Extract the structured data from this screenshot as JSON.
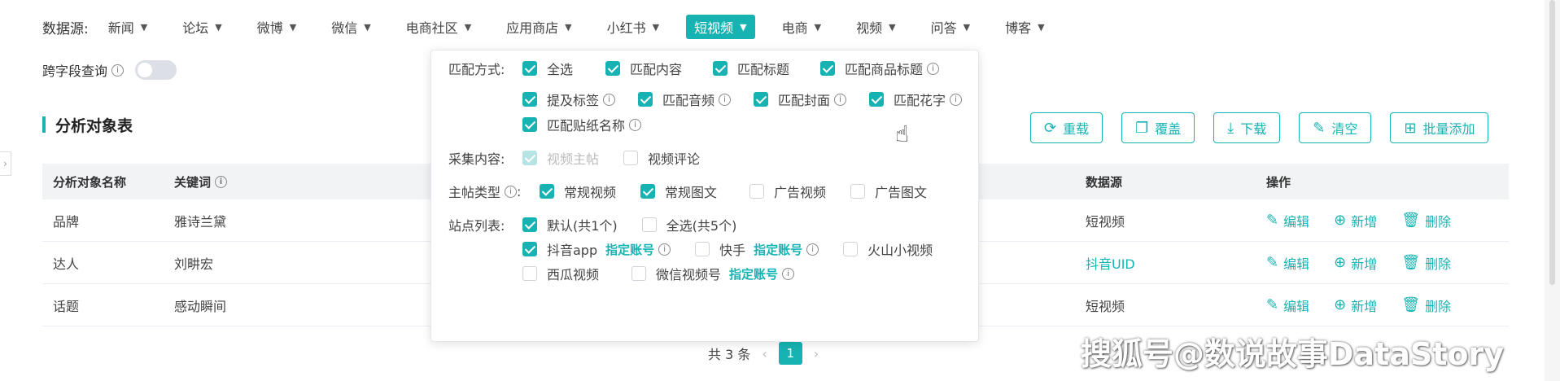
{
  "source_bar": {
    "label": "数据源:",
    "items": [
      "新闻",
      "论坛",
      "微博",
      "微信",
      "电商社区",
      "应用商店",
      "小红书",
      "短视频",
      "电商",
      "视频",
      "问答",
      "博客"
    ],
    "active": "短视频"
  },
  "cross_field": {
    "label": "跨字段查询",
    "enabled": false
  },
  "section": {
    "title": "分析对象表"
  },
  "toolbar": {
    "reset": "重载",
    "overwrite": "覆盖",
    "download": "下载",
    "clear": "清空",
    "batch_add": "批量添加"
  },
  "table": {
    "headers": {
      "name": "分析对象名称",
      "keyword": "关键词",
      "source": "数据源",
      "ops": "操作"
    },
    "rows": [
      {
        "name": "品牌",
        "keyword": "雅诗兰黛",
        "source": "短视频",
        "source_link": false
      },
      {
        "name": "达人",
        "keyword": "刘畊宏",
        "source": "抖音UID",
        "source_link": true
      },
      {
        "name": "话题",
        "keyword": "感动瞬间",
        "source": "短视频",
        "source_link": false
      }
    ],
    "ops": {
      "edit": "编辑",
      "add": "新增",
      "delete": "删除"
    }
  },
  "pager": {
    "total": "共 3 条",
    "current": "1"
  },
  "popover": {
    "match": {
      "label": "匹配方式:",
      "row1": [
        {
          "text": "全选",
          "checked": true,
          "info": false
        },
        {
          "text": "匹配内容",
          "checked": true,
          "info": false
        },
        {
          "text": "匹配标题",
          "checked": true,
          "info": false
        },
        {
          "text": "匹配商品标题",
          "checked": true,
          "info": true
        }
      ],
      "row2": [
        {
          "text": "提及标签",
          "checked": true,
          "info": true
        },
        {
          "text": "匹配音频",
          "checked": true,
          "info": true
        },
        {
          "text": "匹配封面",
          "checked": true,
          "info": true
        },
        {
          "text": "匹配花字",
          "checked": true,
          "info": true
        }
      ],
      "row3": [
        {
          "text": "匹配贴纸名称",
          "checked": true,
          "info": true
        }
      ]
    },
    "collect": {
      "label": "采集内容:",
      "options": [
        {
          "text": "视频主帖",
          "checked": true,
          "disabled": true
        },
        {
          "text": "视频评论",
          "checked": false,
          "disabled": false
        }
      ]
    },
    "post_type": {
      "label": "主帖类型",
      "options": [
        {
          "text": "常规视频",
          "checked": true
        },
        {
          "text": "常规图文",
          "checked": true
        },
        {
          "text": "广告视频",
          "checked": false
        },
        {
          "text": "广告图文",
          "checked": false
        }
      ]
    },
    "sites": {
      "label": "站点列表:",
      "row1": [
        {
          "text": "默认(共1个)",
          "checked": true
        },
        {
          "text": "全选(共5个)",
          "checked": false
        }
      ],
      "row2": [
        {
          "text": "抖音app",
          "checked": true,
          "account": "指定账号"
        },
        {
          "text": "快手",
          "checked": false,
          "account": "指定账号"
        },
        {
          "text": "火山小视频",
          "checked": false,
          "account": ""
        }
      ],
      "row3": [
        {
          "text": "西瓜视频",
          "checked": false,
          "account": ""
        },
        {
          "text": "微信视频号",
          "checked": false,
          "account": "指定账号"
        }
      ]
    }
  },
  "watermark": "搜狐号@数说故事DataStory",
  "colors": {
    "accent": "#17b3b3",
    "header_bg": "#f2f3f5"
  }
}
